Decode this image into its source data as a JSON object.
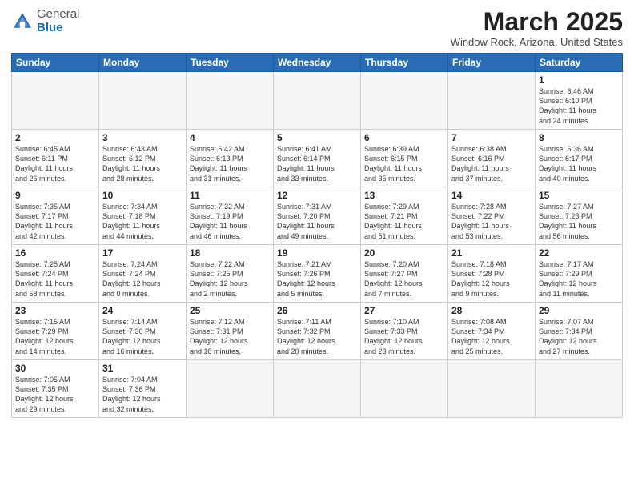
{
  "header": {
    "logo_general": "General",
    "logo_blue": "Blue",
    "month_title": "March 2025",
    "location": "Window Rock, Arizona, United States"
  },
  "days_of_week": [
    "Sunday",
    "Monday",
    "Tuesday",
    "Wednesday",
    "Thursday",
    "Friday",
    "Saturday"
  ],
  "weeks": [
    [
      {
        "day": "",
        "info": "",
        "empty": true
      },
      {
        "day": "",
        "info": "",
        "empty": true
      },
      {
        "day": "",
        "info": "",
        "empty": true
      },
      {
        "day": "",
        "info": "",
        "empty": true
      },
      {
        "day": "",
        "info": "",
        "empty": true
      },
      {
        "day": "",
        "info": "",
        "empty": true
      },
      {
        "day": "1",
        "info": "Sunrise: 6:46 AM\nSunset: 6:10 PM\nDaylight: 11 hours\nand 24 minutes."
      }
    ],
    [
      {
        "day": "2",
        "info": "Sunrise: 6:45 AM\nSunset: 6:11 PM\nDaylight: 11 hours\nand 26 minutes."
      },
      {
        "day": "3",
        "info": "Sunrise: 6:43 AM\nSunset: 6:12 PM\nDaylight: 11 hours\nand 28 minutes."
      },
      {
        "day": "4",
        "info": "Sunrise: 6:42 AM\nSunset: 6:13 PM\nDaylight: 11 hours\nand 31 minutes."
      },
      {
        "day": "5",
        "info": "Sunrise: 6:41 AM\nSunset: 6:14 PM\nDaylight: 11 hours\nand 33 minutes."
      },
      {
        "day": "6",
        "info": "Sunrise: 6:39 AM\nSunset: 6:15 PM\nDaylight: 11 hours\nand 35 minutes."
      },
      {
        "day": "7",
        "info": "Sunrise: 6:38 AM\nSunset: 6:16 PM\nDaylight: 11 hours\nand 37 minutes."
      },
      {
        "day": "8",
        "info": "Sunrise: 6:36 AM\nSunset: 6:17 PM\nDaylight: 11 hours\nand 40 minutes."
      }
    ],
    [
      {
        "day": "9",
        "info": "Sunrise: 7:35 AM\nSunset: 7:17 PM\nDaylight: 11 hours\nand 42 minutes."
      },
      {
        "day": "10",
        "info": "Sunrise: 7:34 AM\nSunset: 7:18 PM\nDaylight: 11 hours\nand 44 minutes."
      },
      {
        "day": "11",
        "info": "Sunrise: 7:32 AM\nSunset: 7:19 PM\nDaylight: 11 hours\nand 46 minutes."
      },
      {
        "day": "12",
        "info": "Sunrise: 7:31 AM\nSunset: 7:20 PM\nDaylight: 11 hours\nand 49 minutes."
      },
      {
        "day": "13",
        "info": "Sunrise: 7:29 AM\nSunset: 7:21 PM\nDaylight: 11 hours\nand 51 minutes."
      },
      {
        "day": "14",
        "info": "Sunrise: 7:28 AM\nSunset: 7:22 PM\nDaylight: 11 hours\nand 53 minutes."
      },
      {
        "day": "15",
        "info": "Sunrise: 7:27 AM\nSunset: 7:23 PM\nDaylight: 11 hours\nand 56 minutes."
      }
    ],
    [
      {
        "day": "16",
        "info": "Sunrise: 7:25 AM\nSunset: 7:24 PM\nDaylight: 11 hours\nand 58 minutes."
      },
      {
        "day": "17",
        "info": "Sunrise: 7:24 AM\nSunset: 7:24 PM\nDaylight: 12 hours\nand 0 minutes."
      },
      {
        "day": "18",
        "info": "Sunrise: 7:22 AM\nSunset: 7:25 PM\nDaylight: 12 hours\nand 2 minutes."
      },
      {
        "day": "19",
        "info": "Sunrise: 7:21 AM\nSunset: 7:26 PM\nDaylight: 12 hours\nand 5 minutes."
      },
      {
        "day": "20",
        "info": "Sunrise: 7:20 AM\nSunset: 7:27 PM\nDaylight: 12 hours\nand 7 minutes."
      },
      {
        "day": "21",
        "info": "Sunrise: 7:18 AM\nSunset: 7:28 PM\nDaylight: 12 hours\nand 9 minutes."
      },
      {
        "day": "22",
        "info": "Sunrise: 7:17 AM\nSunset: 7:29 PM\nDaylight: 12 hours\nand 11 minutes."
      }
    ],
    [
      {
        "day": "23",
        "info": "Sunrise: 7:15 AM\nSunset: 7:29 PM\nDaylight: 12 hours\nand 14 minutes."
      },
      {
        "day": "24",
        "info": "Sunrise: 7:14 AM\nSunset: 7:30 PM\nDaylight: 12 hours\nand 16 minutes."
      },
      {
        "day": "25",
        "info": "Sunrise: 7:12 AM\nSunset: 7:31 PM\nDaylight: 12 hours\nand 18 minutes."
      },
      {
        "day": "26",
        "info": "Sunrise: 7:11 AM\nSunset: 7:32 PM\nDaylight: 12 hours\nand 20 minutes."
      },
      {
        "day": "27",
        "info": "Sunrise: 7:10 AM\nSunset: 7:33 PM\nDaylight: 12 hours\nand 23 minutes."
      },
      {
        "day": "28",
        "info": "Sunrise: 7:08 AM\nSunset: 7:34 PM\nDaylight: 12 hours\nand 25 minutes."
      },
      {
        "day": "29",
        "info": "Sunrise: 7:07 AM\nSunset: 7:34 PM\nDaylight: 12 hours\nand 27 minutes."
      }
    ],
    [
      {
        "day": "30",
        "info": "Sunrise: 7:05 AM\nSunset: 7:35 PM\nDaylight: 12 hours\nand 29 minutes."
      },
      {
        "day": "31",
        "info": "Sunrise: 7:04 AM\nSunset: 7:36 PM\nDaylight: 12 hours\nand 32 minutes."
      },
      {
        "day": "",
        "info": "",
        "empty": true
      },
      {
        "day": "",
        "info": "",
        "empty": true
      },
      {
        "day": "",
        "info": "",
        "empty": true
      },
      {
        "day": "",
        "info": "",
        "empty": true
      },
      {
        "day": "",
        "info": "",
        "empty": true
      }
    ]
  ]
}
